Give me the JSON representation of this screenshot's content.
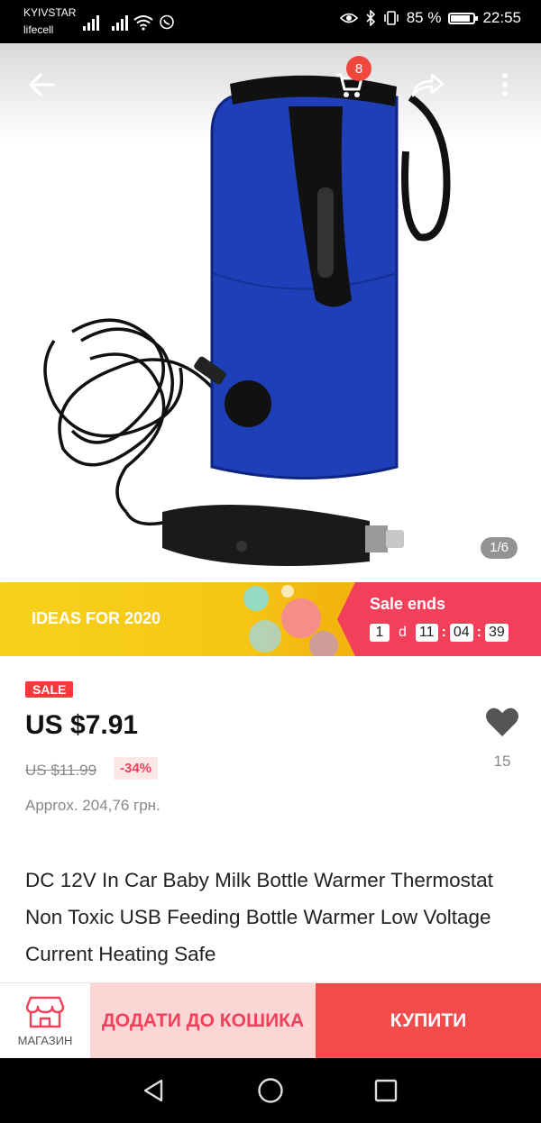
{
  "status_bar": {
    "carrier_primary": "KYIVSTAR",
    "carrier_secondary": "lifecell",
    "battery_percent": "85 %",
    "battery_level": 0.85,
    "time": "22:55"
  },
  "header": {
    "back_icon": "arrow-left-icon",
    "cart_icon": "cart-icon",
    "cart_count": "8",
    "share_icon": "share-icon",
    "more_icon": "more-vertical-icon"
  },
  "gallery": {
    "page_indicator": "1/6"
  },
  "promo": {
    "banner_text": "IDEAS FOR 2020",
    "sale_ends_label": "Sale ends",
    "days": "1",
    "days_label": "d",
    "hours": "11",
    "minutes": "04",
    "seconds": "39",
    "colors": {
      "yellow": "#f7d11e",
      "pink": "#f2405b"
    }
  },
  "product": {
    "sale_badge": "SALE",
    "price": "US $7.91",
    "old_price": "US $11.99",
    "discount": "-34%",
    "approx_price": "Approx. 204,76 грн.",
    "wishlist_count": "15",
    "title": "DC 12V In Car Baby Milk Bottle Warmer Thermostat Non Toxic USB Feeding Bottle Warmer Low Voltage Current Heating Safe"
  },
  "actions": {
    "store_label": "МАГАЗИН",
    "add_to_cart_label": "ДОДАТИ ДО КОШИКА",
    "buy_label": "КУПИТИ",
    "colors": {
      "add_bg": "#fcd5d5",
      "buy_bg": "#f24b4b",
      "accent": "#f2405b"
    }
  },
  "system_nav": {
    "back_icon": "triangle-back-icon",
    "home_icon": "circle-home-icon",
    "recents_icon": "square-recents-icon"
  }
}
